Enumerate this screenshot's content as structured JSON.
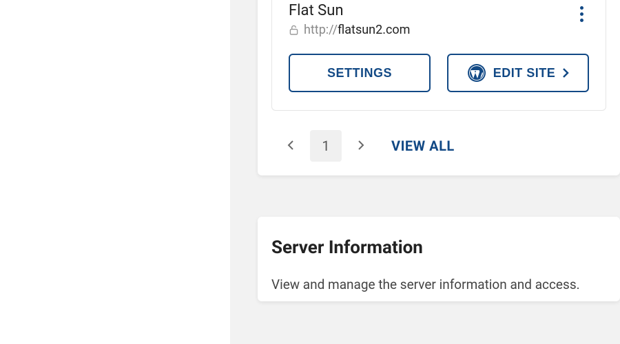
{
  "site_card": {
    "title": "Flat Sun",
    "url_scheme": "http://",
    "url_host": "flatsun2.com",
    "settings_label": "SETTINGS",
    "edit_site_label": "EDIT SITE"
  },
  "pagination": {
    "current_page": "1",
    "view_all_label": "VIEW ALL"
  },
  "server_info": {
    "title": "Server Information",
    "description": "View and manage the server information and access."
  }
}
